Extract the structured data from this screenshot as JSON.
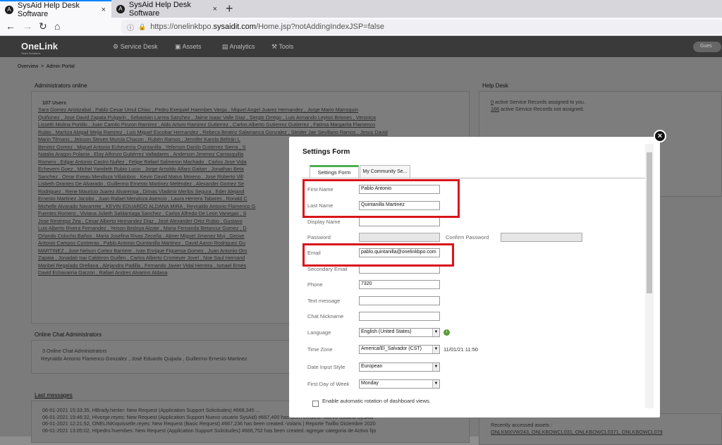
{
  "browser": {
    "tabs": [
      {
        "title": "SysAid Help Desk Software",
        "close": "×"
      },
      {
        "title": "SysAid Help Desk Software",
        "close": "×"
      }
    ],
    "new_tab": "+",
    "url_prefix": "https://onelinkbpo.",
    "url_domain": "sysaidit.com",
    "url_rest": "/Home.jsp?notAddingIndexJSP=false"
  },
  "app": {
    "logo": "OneLink",
    "logo_tag": "Team Solutions",
    "nav": [
      "Service Desk",
      "Assets",
      "Analytics",
      "Tools"
    ],
    "guest_button": "Gues"
  },
  "breadcrumb": {
    "home": "Overview",
    "sep": ">",
    "current": "Admin Portal"
  },
  "admins_online": {
    "title": "Administrators online",
    "count": "107 Users",
    "lines": [
      "Sara Gomez Aristizabal , Pablo Cesar Umul Chioc , Pedro Exequiel Haembes Varga , Miguel Angel Juarez Hernandez , Jorge Mario Marroquin",
      "Quiñonez , Jose David Zapata Pulgarin , Sebastián Larrea Sanchez , Jaime Isaac Valle Diaz , Sergio Orrego , Luis Armando Leyton Briones , Veronica",
      "Lisseth Molina Portillo , Juan Camilo Pinzon Ramirez , Aldo Arturo Ramirez Gutierrez , Carlos Alberto Gutierrez Gutierrez , Fatima Margarita Flamenco",
      "Rubio , Maritza Abigail Mejia Ramirez , Luis Miguel Escobar Hernandez , Rebeca Beatriz Salamanca Gonzalez , Sleider Jair Sevillano Ramos , Jesus David",
      "Marin Tilmans , Jeisson Steven Murcia Chacon , Rubén Ramos , Jennifer Karola Beltrán L",
      "Benitez Gomez , Miguel Antonio Echeverria Quintanilla , Yeferson Danilo Gutierrez Sierra , S",
      "Natalia Aragon Polania , Eloy Alfonzo Gutiérrez Valladares , Anderson Jimenez Carrasquilla",
      "Romero , Edgar Antonio Castro Nuñez , Felipe Rafael Salmeron Machado , Carlos Jose Vida",
      "Echeverri Goez , Michel Yamileth Rubio Lucio , Jorge Arnoldo Alfaro Gaitan , Jonathan Beta",
      "Sanchez , Omar Exeau Mendoza Villalobos , Kevin David Matus Moreno , Jose Roberto Vill",
      "Lisbeth Orantes De Alvarado , Guillermo Ernesto Martinez Meléndez , Alexander Gomez Se",
      "Rodriguez , Rene Mauricio Juarez Alvarenga , Dimas Vladimir Merlos Segura , Eder Alejand",
      "Ernesto Martinez Jacobo , Juan Rafael Mendoza Asencio , Laura Herrera Tabares , Ronald C",
      "Michelle Alvarado Navarrete , KEVIN EDUARDO ALDANA MIRA , Reynaldo Antonio Flamenco G",
      "Fuentes Romero , Viviana Julieth Saldarriaga Sanchez , Carlos Alfredo De Leon Vanegas , S",
      "Jose Restrepo Zea , Cesar Alberto Hernandez Diaz , José Alexander Ortiz Rubio , Gustavo",
      "Luis Alberto Rivera Fernandez , Yeison Bedoya Alzate , Maria Fernanda Betancur Gomez , D",
      "Orlando Colocho Baños , Maria Josefina Rivas Zeceña , Abner Miguel Jimenez Muj , Geove",
      "Antonio Campos Contreras , Pablo Antonio Quintanilla Martinez , David Aaron Rodriguez Gu",
      "MARTINEZ , Jose Nelson Cortez Barriere , Ivan Enrique Figueroa Gomez , Juan Antonio Oro",
      "Zapata , Jonadab Isai Calderon Guillen , Carlos Alberto Cromeyer Jovel , Noe Saul Hernand",
      "Maribel Regalado Orellana , Alejandra Padilla , Fernando Javier Vidal Herrera , Ismael Ernes",
      "David Echavarría Garzón , Rafael Andres Alvarino Aldana"
    ]
  },
  "chat_admins": {
    "title": "Online Chat Administrators",
    "count": "3 Online Chat Administrators",
    "names": "Reynaldo Antonio Flamenco Gonzalez , José Eduardo Quijada , Guillermo Ernesto Martinez"
  },
  "last_messages": {
    "title": "Last messages",
    "rows": [
      "06-01-2021 15:33:35, HBrady.himler: New Request (Application Support Solicitudes) #668,345 ...",
      "06-01-2021 19:46:32, HIvorge.reyes: New Request (Application Support Nuevo usuario SysAid) #667,400 has been created.-Nuevo usuario SysAid",
      "06-01-2021 12:21:52, ONELINK\\quisselle.reyes: New Request (Basic Request) #667,236 has been created.-Volaris | Reporte Twillio Diciembre 2020",
      "06-01-2021 13:05:02, HIpedro.huembes: New Request (Application Support Solicitudes) #666,752 has been created.-agregar categoria de Activo fijo"
    ]
  },
  "help_desk": {
    "title": "Help Desk",
    "assigned_count": "0",
    "assigned_text": "active Service Records assigned to you.",
    "unassigned_count": "166",
    "unassigned_text": "active Service Records not assigned.",
    "recent_label": "Recently accessed assets :",
    "recent_assets": "ONLKMXVW243, ONLKBOWCL031, ONLKBOWCL0371, ONLKBOWCL079"
  },
  "settings_form": {
    "title": "Settings Form",
    "close": "×",
    "tabs": [
      "Settings Form",
      "My Community Se..."
    ],
    "fields": {
      "first_name": {
        "label": "First Name",
        "value": "Pablo Antonio"
      },
      "last_name": {
        "label": "Last Name",
        "value": "Quintanilla Martinez"
      },
      "display_name": {
        "label": "Display Name",
        "value": ""
      },
      "password": {
        "label": "Password",
        "value": ""
      },
      "confirm_password": {
        "label": "Confirm Password",
        "value": ""
      },
      "email": {
        "label": "Email",
        "value": "pablo.quintanilla@onelinkbpo.com"
      },
      "secondary_email": {
        "label": "Secondary Email",
        "value": ""
      },
      "phone": {
        "label": "Phone",
        "value": "7320"
      },
      "text_message": {
        "label": "Text message",
        "value": ""
      },
      "chat_nickname": {
        "label": "Chat Nickname",
        "value": ""
      },
      "language": {
        "label": "Language",
        "value": "English (United States)"
      },
      "time_zone": {
        "label": "Time Zone",
        "value": "America/El_Salvador (CST)",
        "time": "11/01/21 11:50"
      },
      "date_input_style": {
        "label": "Date Input Style",
        "value": "European"
      },
      "first_day_of_week": {
        "label": "First Day of Week",
        "value": "Monday"
      }
    },
    "auto_rotate_label": "Enable automatic rotation of dashboard views.",
    "highlight_color": "#d9141c"
  }
}
